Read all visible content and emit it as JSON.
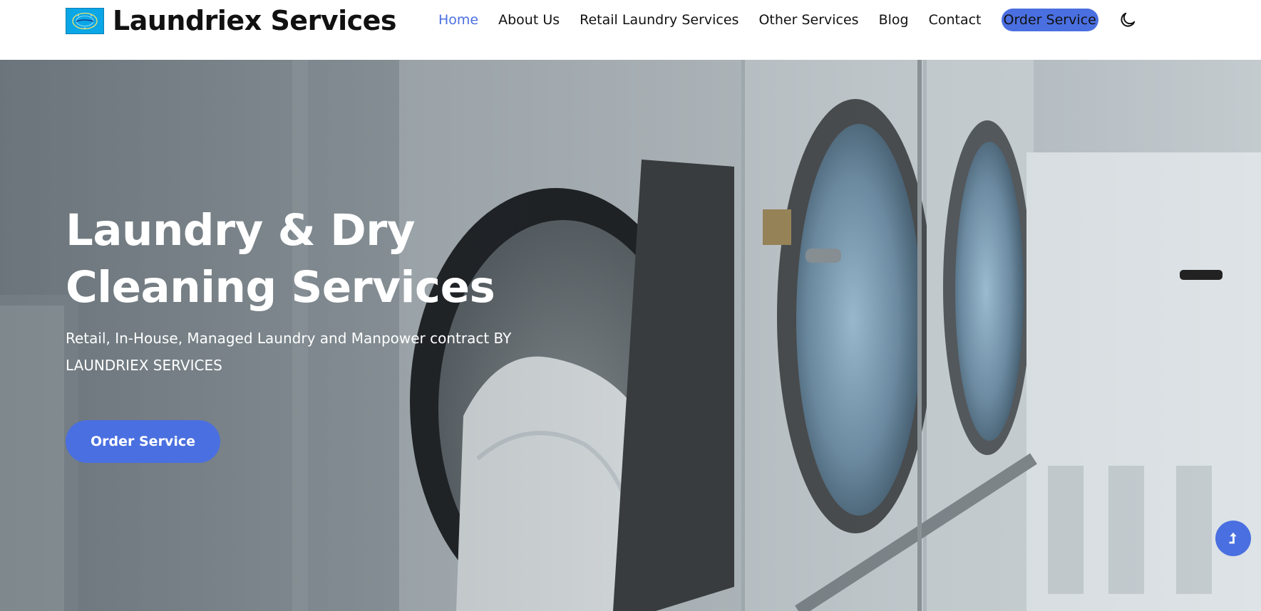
{
  "brand": {
    "name": "Laundriex Services",
    "logo_icon": "laundriex-logo"
  },
  "nav": {
    "items": [
      {
        "label": "Home",
        "active": true
      },
      {
        "label": "About Us"
      },
      {
        "label": "Retail Laundry Services"
      },
      {
        "label": "Other Services"
      },
      {
        "label": "Blog"
      },
      {
        "label": "Contact"
      }
    ],
    "order_label": "Order Service",
    "theme_toggle_icon": "moon-icon"
  },
  "hero": {
    "title_line1": "Laundry & Dry",
    "title_line2": "Cleaning Services",
    "subtitle_line1": "Retail, In-House, Managed Laundry and Manpower contract BY",
    "subtitle_line2": "LAUNDRIEX SERVICES",
    "cta_label": "Order Service",
    "background": "laundromat-washing-machines-photo"
  },
  "scroll_top_icon": "arrow-up-icon",
  "colors": {
    "accent": "#4a6fe0",
    "active_nav": "#4a6fe0",
    "hero_text": "#ffffff"
  }
}
